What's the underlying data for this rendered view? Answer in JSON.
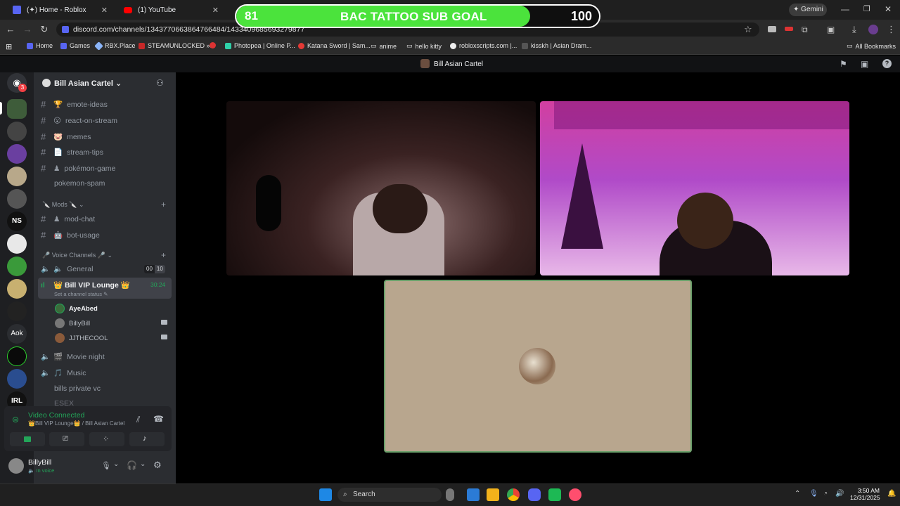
{
  "browser": {
    "tabs": [
      {
        "label": "(✦) Home - Roblox"
      },
      {
        "label": "(1) YouTube"
      }
    ],
    "gemini_label": "Gemini",
    "url": "discord.com/channels/1343770663864766484/1433409685693279877",
    "bookmarks": [
      "Home",
      "Games",
      "RBX.Place",
      "STEAMUNLOCKED »...",
      "Photopea | Online P...",
      "Katana Sword | Sam...",
      "anime",
      "hello kitty",
      "robloxscripts.com |...",
      "kisskh | Asian Dram..."
    ],
    "all_bookmarks_label": "All Bookmarks"
  },
  "sub_goal": {
    "title": "BAC TATTOO SUB GOAL",
    "current": "81",
    "target": "100",
    "progress": 0.81
  },
  "discord": {
    "header_title": "Bill Asian Cartel",
    "rail_badge": "3",
    "server_name": "Bill Asian Cartel",
    "channels_top": [
      {
        "icon": "🏆",
        "name": "emote-ideas"
      },
      {
        "icon": "😮",
        "name": "react-on-stream"
      },
      {
        "icon": "🐷",
        "name": "memes"
      },
      {
        "icon": "📄",
        "name": "stream-tips"
      },
      {
        "icon": "♟",
        "name": "pokémon-game"
      },
      {
        "icon": "",
        "name": "pokemon-spam"
      }
    ],
    "mods_category": "Mods",
    "mod_channels": [
      {
        "icon": "♟",
        "name": "mod-chat"
      },
      {
        "icon": "🤖",
        "name": "bot-usage"
      }
    ],
    "voice_category": "Voice Channels",
    "voice_general": {
      "name": "General",
      "count_a": "00",
      "count_b": "10"
    },
    "voice_active": {
      "name": "👑 Bill VIP Lounge 👑",
      "timer": "30:24",
      "status": "Set a channel status"
    },
    "voice_users": [
      "AyeAbed",
      "BillyBill",
      "JJTHECOOL"
    ],
    "voice_more": [
      {
        "icon": "🎬",
        "name": "Movie night"
      },
      {
        "icon": "🎵",
        "name": "Music"
      },
      {
        "icon": "",
        "name": "bills private vc"
      },
      {
        "icon": "",
        "name": "ESEX"
      }
    ],
    "connection": {
      "status": "Video Connected",
      "location": "👑Bill VIP Lounge👑 / Bill Asian Cartel"
    },
    "user": {
      "name": "BillyBill",
      "status": "In voice"
    }
  },
  "rail_labels": {
    "ns": "NS",
    "aok": "Aok",
    "irl": "IRL"
  },
  "taskbar": {
    "search_label": "Search",
    "time": "3:50 AM",
    "date": "12/31/2025"
  },
  "colors": {
    "goal_fill": "#4be33c",
    "discord_bg": "#2b2d31",
    "connected_green": "#23a559",
    "active_channel": "#404249"
  }
}
